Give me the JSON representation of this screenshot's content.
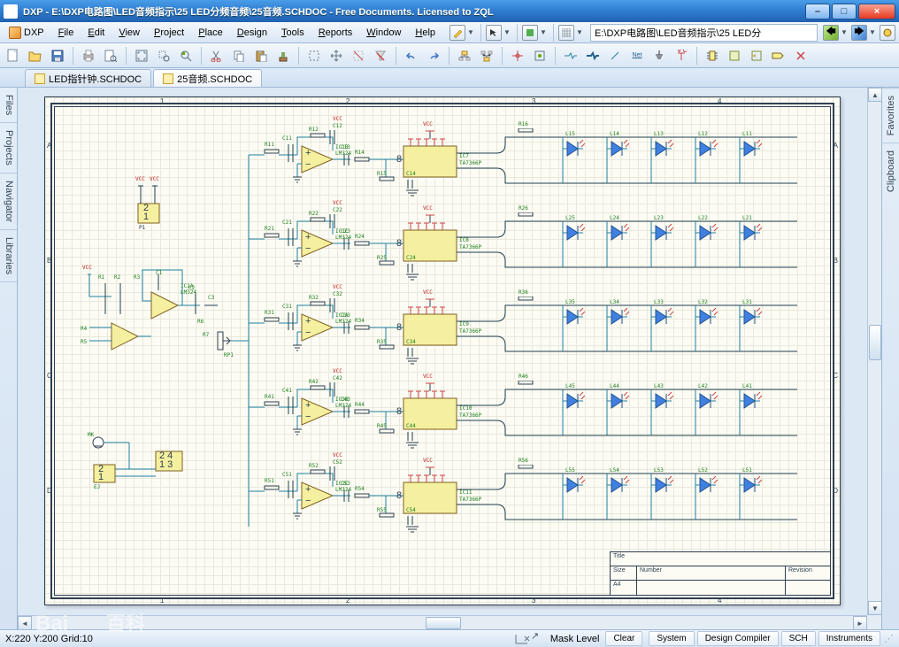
{
  "window": {
    "title": "DXP - E:\\DXP电路图\\LED音频指示\\25 LED分频音频\\25音频.SCHDOC - Free Documents. Licensed to ZQL",
    "minimize": "–",
    "maximize": "□",
    "close": "×"
  },
  "menu": {
    "home": "DXP",
    "items": [
      "File",
      "Edit",
      "View",
      "Project",
      "Place",
      "Design",
      "Tools",
      "Reports",
      "Window",
      "Help"
    ],
    "path": "E:\\DXP电路图\\LED音频指示\\25 LED分"
  },
  "tabs": {
    "doc1": "LED指针钟.SCHDOC",
    "doc2": "25音频.SCHDOC"
  },
  "side_left": [
    "Files",
    "Projects",
    "Navigator",
    "Libraries"
  ],
  "side_right": [
    "Favorites",
    "Clipboard"
  ],
  "schematic": {
    "zones_left": [
      "A",
      "B",
      "C",
      "D"
    ],
    "zones_top": [
      "1",
      "2",
      "3",
      "4"
    ],
    "vcc": "VCC",
    "conn_p1": {
      "ref": "P1",
      "pins": [
        "2",
        "1"
      ]
    },
    "conn_ej": {
      "ref": "EJ",
      "pins": [
        "2",
        "1"
      ]
    },
    "conn_p2": {
      "pins": [
        "2 4",
        "1 3"
      ]
    },
    "mk": "MK",
    "opamp_main": {
      "ref": "IC1A",
      "part": "LM324"
    },
    "r_main": [
      "R1",
      "R2",
      "R3",
      "R4",
      "R5",
      "R6",
      "R7"
    ],
    "c_main": [
      "C1",
      "C2",
      "C3"
    ],
    "rp1": "RP1",
    "stages": [
      {
        "r_in": "R11",
        "c_a": "C11",
        "r_fb": "R12",
        "c_b": "C12",
        "ic": "IC1B",
        "part": "LM324",
        "c_out": "C13",
        "r_out": "R14",
        "r_d": "R15",
        "c_d": "C14",
        "chip": "IC7",
        "chip_p": "TA7366P",
        "r_led": "R16",
        "leds": [
          "L15",
          "L14",
          "L13",
          "L12",
          "L11"
        ]
      },
      {
        "r_in": "R21",
        "c_a": "C21",
        "r_fb": "R22",
        "c_b": "C22",
        "ic": "IC1C",
        "part": "LM324",
        "c_out": "C23",
        "r_out": "R24",
        "r_d": "R25",
        "c_d": "C24",
        "chip": "IC8",
        "chip_p": "TA7366P",
        "r_led": "R26",
        "leds": [
          "L25",
          "L24",
          "L23",
          "L22",
          "L21"
        ]
      },
      {
        "r_in": "R31",
        "c_a": "C31",
        "r_fb": "R32",
        "c_b": "C32",
        "ic": "IC2A",
        "part": "LM324",
        "c_out": "C33",
        "r_out": "R34",
        "r_d": "R35",
        "c_d": "C34",
        "chip": "IC9",
        "chip_p": "TA7366P",
        "r_led": "R36",
        "leds": [
          "L35",
          "L34",
          "L33",
          "L32",
          "L31"
        ]
      },
      {
        "r_in": "R41",
        "c_a": "C41",
        "r_fb": "R42",
        "c_b": "C42",
        "ic": "IC2B",
        "part": "LM324",
        "c_out": "C43",
        "r_out": "R44",
        "r_d": "R45",
        "c_d": "C44",
        "chip": "IC10",
        "chip_p": "TA7366P",
        "r_led": "R46",
        "leds": [
          "L45",
          "L44",
          "L43",
          "L42",
          "L41"
        ]
      },
      {
        "r_in": "R51",
        "c_a": "C51",
        "r_fb": "R52",
        "c_b": "C52",
        "ic": "IC2C",
        "part": "LM324",
        "c_out": "C53",
        "r_out": "R54",
        "r_d": "R55",
        "c_d": "C54",
        "chip": "IC11",
        "chip_p": "TA7366P",
        "r_led": "R56",
        "leds": [
          "L55",
          "L54",
          "L53",
          "L52",
          "L51"
        ]
      }
    ],
    "pins_driver": "8",
    "titleblock": {
      "title_l": "Title",
      "size_l": "Size",
      "size_v": "A4",
      "number_l": "Number",
      "rev_l": "Revision"
    }
  },
  "status": {
    "coords": "X:220 Y:200   Grid:10",
    "mask": "Mask Level",
    "clear": "Clear",
    "panels": [
      "System",
      "Design Compiler",
      "SCH",
      "Instruments"
    ]
  },
  "watermark1": "Bai",
  "watermark2": "百科"
}
